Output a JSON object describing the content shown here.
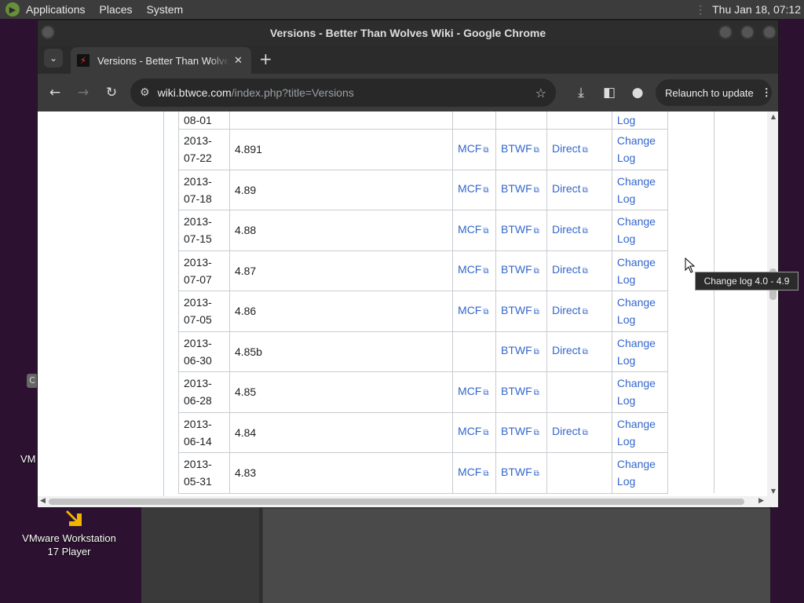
{
  "top_panel": {
    "menus": [
      "Applications",
      "Places",
      "System"
    ],
    "clock": "Thu Jan 18, 07:12"
  },
  "desktop": {
    "vmware_label": "VMware Workstation 17 Player",
    "partial_label": "VM"
  },
  "window": {
    "title": "Versions - Better Than Wolves Wiki - Google Chrome"
  },
  "tab": {
    "title": "Versions - Better Than Wolves Wiki"
  },
  "omnibox": {
    "host": "wiki.btwce.com",
    "path": "/index.php?title=Versions"
  },
  "toolbar": {
    "relaunch_label": "Relaunch to update"
  },
  "table": {
    "top_partial_date": "08-01",
    "top_partial_log": "Log",
    "rows": [
      {
        "date1": "2013-",
        "date2": "07-22",
        "version": "4.891",
        "mcf": "MCF",
        "btwf": "BTWF",
        "direct": "Direct",
        "log1": "Change",
        "log2": "Log"
      },
      {
        "date1": "2013-",
        "date2": "07-18",
        "version": "4.89",
        "mcf": "MCF",
        "btwf": "BTWF",
        "direct": "Direct",
        "log1": "Change",
        "log2": "Log"
      },
      {
        "date1": "2013-",
        "date2": "07-15",
        "version": "4.88",
        "mcf": "MCF",
        "btwf": "BTWF",
        "direct": "Direct",
        "log1": "Change",
        "log2": "Log"
      },
      {
        "date1": "2013-",
        "date2": "07-07",
        "version": "4.87",
        "mcf": "MCF",
        "btwf": "BTWF",
        "direct": "Direct",
        "log1": "Change",
        "log2": "Log"
      },
      {
        "date1": "2013-",
        "date2": "07-05",
        "version": "4.86",
        "mcf": "MCF",
        "btwf": "BTWF",
        "direct": "Direct",
        "log1": "Change",
        "log2": "Log"
      },
      {
        "date1": "2013-",
        "date2": "06-30",
        "version": "4.85b",
        "mcf": "",
        "btwf": "BTWF",
        "direct": "Direct",
        "log1": "Change",
        "log2": "Log"
      },
      {
        "date1": "2013-",
        "date2": "06-28",
        "version": "4.85",
        "mcf": "MCF",
        "btwf": "BTWF",
        "direct": "",
        "log1": "Change",
        "log2": "Log"
      },
      {
        "date1": "2013-",
        "date2": "06-14",
        "version": "4.84",
        "mcf": "MCF",
        "btwf": "BTWF",
        "direct": "Direct",
        "log1": "Change",
        "log2": "Log"
      },
      {
        "date1": "2013-",
        "date2": "05-31",
        "version": "4.83",
        "mcf": "MCF",
        "btwf": "BTWF",
        "direct": "",
        "log1": "Change",
        "log2": "Log"
      }
    ]
  },
  "tooltip": {
    "text": "Change log 4.0 - 4.9"
  },
  "colors": {
    "link": "#3366cc",
    "panel": "#3c3c3c",
    "chrome_toolbar": "#3b3b3b"
  }
}
